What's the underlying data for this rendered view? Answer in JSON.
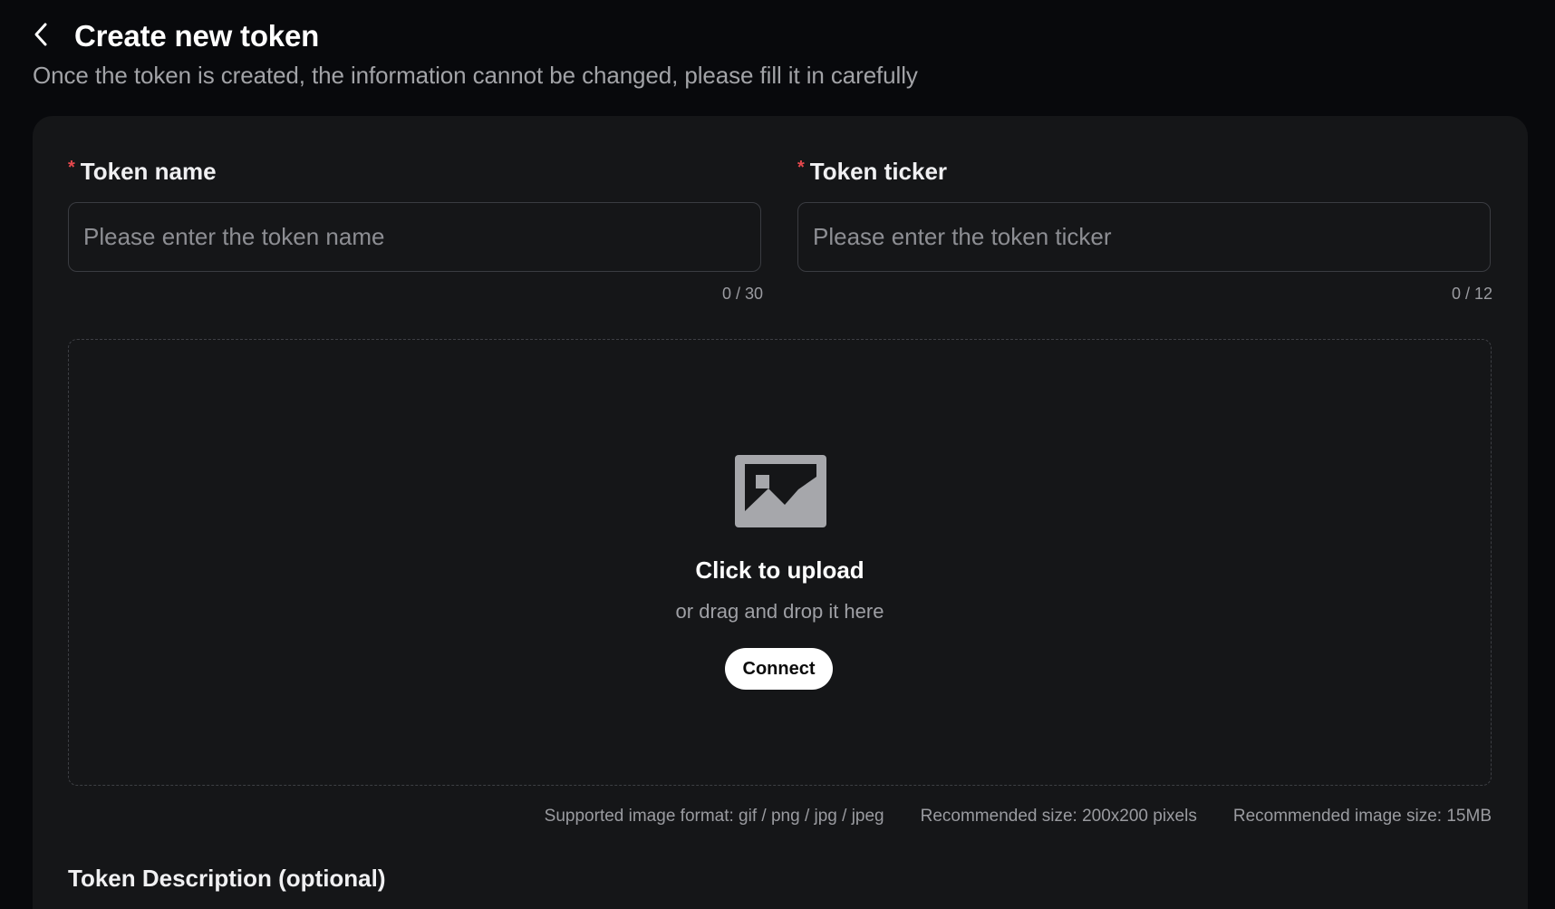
{
  "header": {
    "title": "Create new token",
    "subtitle": "Once the token is created, the information cannot be changed, please fill it in carefully",
    "back_icon": "chevron-left-icon"
  },
  "form": {
    "token_name": {
      "required_mark": "*",
      "label": "Token name",
      "value": "",
      "placeholder": "Please enter the token name",
      "counter": "0 / 30"
    },
    "token_ticker": {
      "required_mark": "*",
      "label": "Token ticker",
      "value": "",
      "placeholder": "Please enter the token ticker",
      "counter": "0 / 12"
    },
    "upload": {
      "icon": "image-icon",
      "title": "Click to upload",
      "subtitle": "or drag and drop it here",
      "button_label": "Connect",
      "hints": [
        "Supported image format: gif / png / jpg / jpeg",
        "Recommended size: 200x200 pixels",
        "Recommended image size: 15MB"
      ]
    },
    "description": {
      "label": "Token Description (optional)"
    }
  },
  "colors": {
    "page_bg": "#08090c",
    "card_bg": "#151618",
    "required": "#e5484d",
    "button_bg": "#ffffff"
  }
}
